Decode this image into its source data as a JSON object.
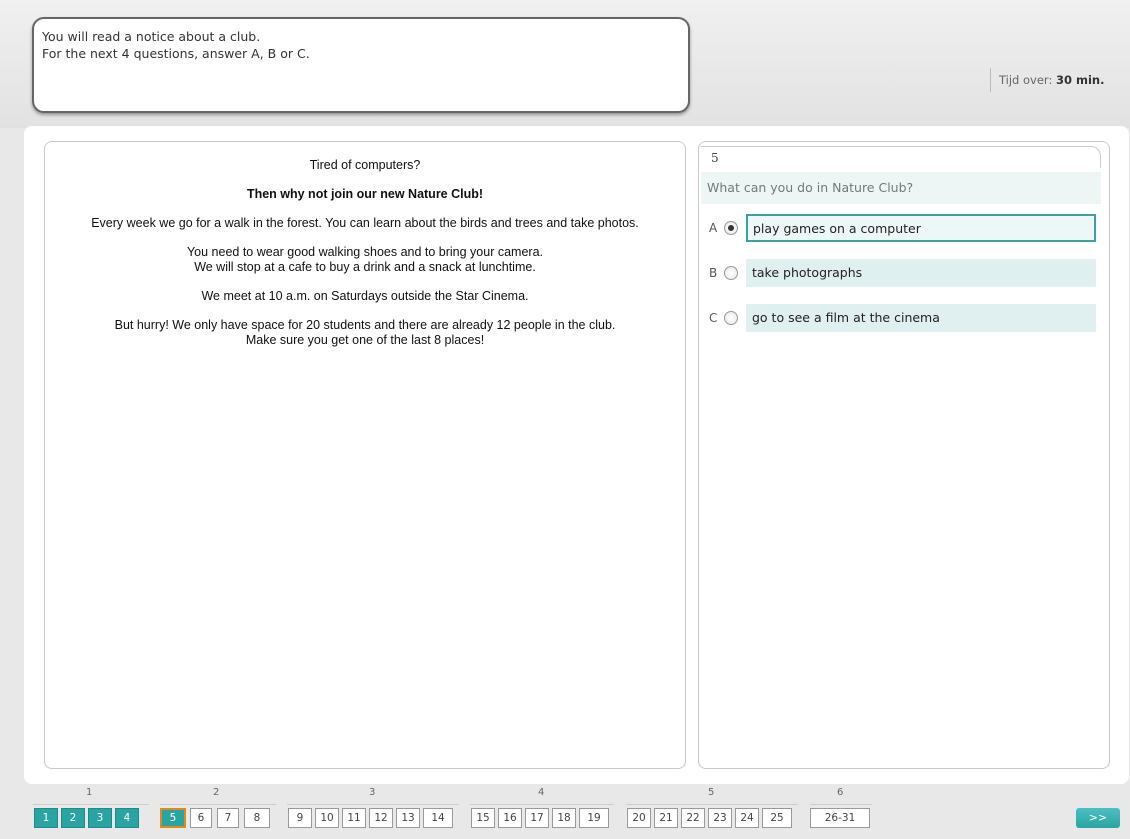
{
  "instructions": {
    "line1": "You will read a notice about a club.",
    "line2": "For the next 4 questions, answer A, B or C."
  },
  "timer": {
    "label": "Tijd over:",
    "value": "30 min."
  },
  "notice": {
    "p1": "Tired of computers?",
    "p2": "Then why not join our new Nature Club!",
    "p3": "Every week we go for a walk in the forest. You can learn about the birds and trees and take photos.",
    "p4a": "You need to wear good walking shoes and to bring your camera.",
    "p4b": "We will stop at a cafe to buy a drink and a snack at lunchtime.",
    "p5": "We meet at 10 a.m. on Saturdays outside the Star Cinema.",
    "p6a": "But hurry! We only have space for 20 students and there are already 12 people in the club.",
    "p6b": "Make sure you get one of the last 8 places!"
  },
  "question": {
    "number": "5",
    "prompt": "What can you do in Nature Club?",
    "options": [
      {
        "letter": "A",
        "text": "play games on a computer",
        "selected": true
      },
      {
        "letter": "B",
        "text": "take photographs",
        "selected": false
      },
      {
        "letter": "C",
        "text": "go to see a film at the cinema",
        "selected": false
      }
    ]
  },
  "navigation": {
    "groups": [
      {
        "label": "1",
        "buttons": [
          "1",
          "2",
          "3",
          "4"
        ]
      },
      {
        "label": "2",
        "buttons": [
          "5",
          "6",
          "7",
          "8"
        ]
      },
      {
        "label": "3",
        "buttons": [
          "9",
          "10",
          "11",
          "12",
          "13",
          "14"
        ]
      },
      {
        "label": "4",
        "buttons": [
          "15",
          "16",
          "17",
          "18",
          "19"
        ]
      },
      {
        "label": "5",
        "buttons": [
          "20",
          "21",
          "22",
          "23",
          "24",
          "25"
        ]
      },
      {
        "label": "6",
        "buttons": [
          "26-31"
        ]
      }
    ],
    "next_label": ">>"
  }
}
